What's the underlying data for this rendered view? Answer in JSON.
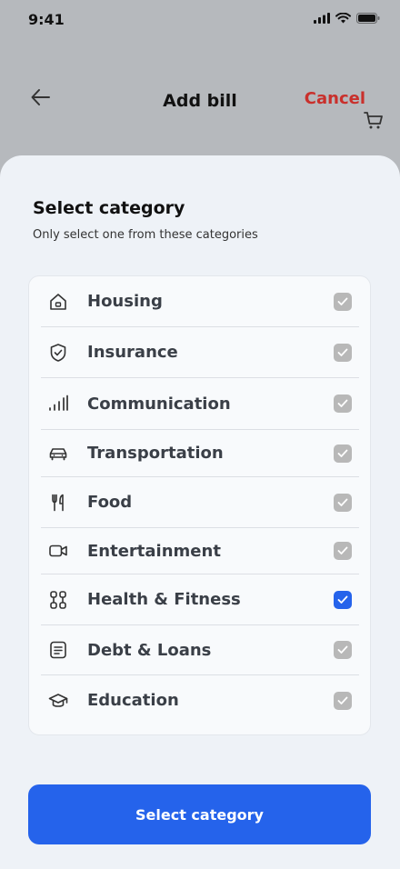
{
  "status_bar": {
    "time": "9:41"
  },
  "header": {
    "title": "Add bill",
    "cancel_label": "Cancel"
  },
  "sheet": {
    "title": "Select category",
    "subtitle": "Only select one from these categories",
    "categories": [
      {
        "label": "Housing",
        "icon": "house-icon",
        "selected": false
      },
      {
        "label": "Insurance",
        "icon": "shield-icon",
        "selected": false
      },
      {
        "label": "Communication",
        "icon": "signal-icon",
        "selected": false
      },
      {
        "label": "Transportation",
        "icon": "car-icon",
        "selected": false
      },
      {
        "label": "Food",
        "icon": "fork-knife-icon",
        "selected": false
      },
      {
        "label": "Entertainment",
        "icon": "video-icon",
        "selected": false
      },
      {
        "label": "Health & Fitness",
        "icon": "dumbbell-icon",
        "selected": true
      },
      {
        "label": "Debt & Loans",
        "icon": "document-icon",
        "selected": false
      },
      {
        "label": "Education",
        "icon": "graduation-cap-icon",
        "selected": false
      }
    ],
    "button_label": "Select category"
  },
  "colors": {
    "accent": "#2563eb",
    "cancel": "#c9302c",
    "check_off": "#b8b8b8"
  }
}
